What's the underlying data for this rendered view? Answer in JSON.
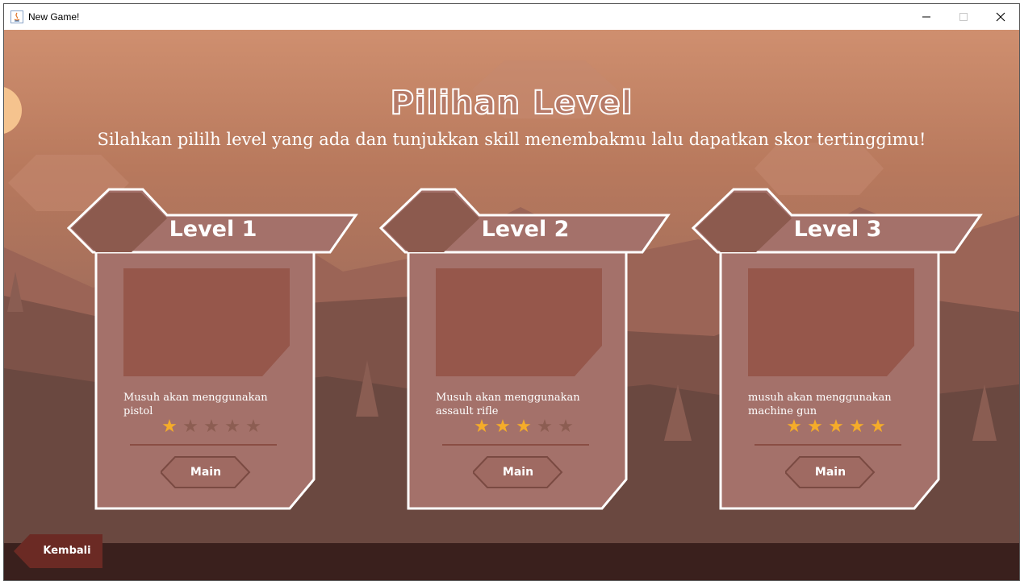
{
  "window": {
    "title": "New Game!"
  },
  "header": {
    "title": "Pilihan Level",
    "subtitle": "Silahkan pililh level yang ada dan tunjukkan skill menembakmu lalu dapatkan skor tertinggimu!"
  },
  "levels": [
    {
      "title": "Level 1",
      "description": "Musuh akan menggunakan pistol",
      "rating": 1,
      "max_rating": 5,
      "button_label": "Main"
    },
    {
      "title": "Level 2",
      "description": "Musuh akan menggunakan assault rifle",
      "rating": 3,
      "max_rating": 5,
      "button_label": "Main"
    },
    {
      "title": "Level 3",
      "description": "musuh akan menggunakan machine gun",
      "rating": 5,
      "max_rating": 5,
      "button_label": "Main"
    }
  ],
  "footer": {
    "back_label": "Kembali"
  },
  "colors": {
    "star_on": "#f5ac29",
    "star_off": "#8c5d52",
    "card_fill": "#a4716a",
    "image_placeholder": "#96574b"
  },
  "icons": {
    "app": "java-icon",
    "minimize": "minimize-icon",
    "maximize": "maximize-icon",
    "close": "close-icon",
    "star": "star-icon"
  }
}
